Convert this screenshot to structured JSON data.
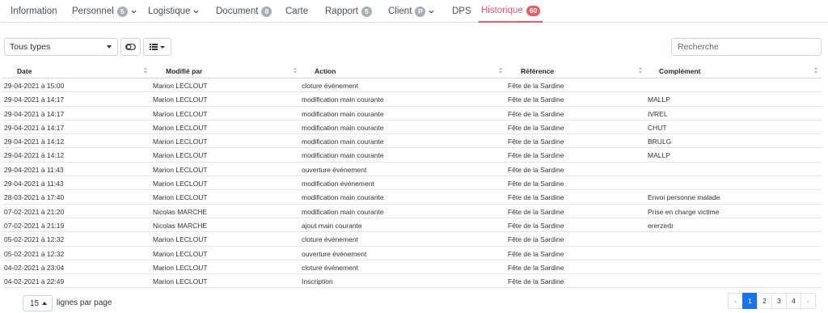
{
  "tabs": [
    {
      "label": "Information"
    },
    {
      "label": "Personnel",
      "badge": "5",
      "dropdown": true
    },
    {
      "label": "Logistique",
      "dropdown": true
    },
    {
      "label": "Document",
      "badge": "8"
    },
    {
      "label": "Carte"
    },
    {
      "label": "Rapport",
      "badge": "5"
    },
    {
      "label": "Client",
      "badge": "P",
      "dropdown": true
    },
    {
      "label": "DPS"
    },
    {
      "label": "Historique",
      "badge": "60",
      "active": true
    }
  ],
  "toolbar": {
    "type_select_value": "Tous types",
    "search_placeholder": "Recherche"
  },
  "table": {
    "columns": [
      "Date",
      "Modifié par",
      "Action",
      "Référence",
      "Complément"
    ],
    "rows": [
      [
        "29-04-2021 à 15:00",
        "Marion LECLOUT",
        "cloture événement",
        "Fête de la Sardine",
        ""
      ],
      [
        "29-04-2021 à 14:17",
        "Marion LECLOUT",
        "modification main courante",
        "Fête de la Sardine",
        "MALLP"
      ],
      [
        "29-04-2021 à 14:17",
        "Marion LECLOUT",
        "modification main courante",
        "Fête de la Sardine",
        "IVREL"
      ],
      [
        "29-04-2021 à 14:17",
        "Marion LECLOUT",
        "modification main courante",
        "Fête de la Sardine",
        "CHUT"
      ],
      [
        "29-04-2021 à 14:12",
        "Marion LECLOUT",
        "modification main courante",
        "Fête de la Sardine",
        "BRULG"
      ],
      [
        "29-04-2021 à 14:12",
        "Marion LECLOUT",
        "modification main courante",
        "Fête de la Sardine",
        "MALLP"
      ],
      [
        "29-04-2021 à 11:43",
        "Marion LECLOUT",
        "ouverture événement",
        "Fête de la Sardine",
        ""
      ],
      [
        "29-04-2021 à 11:43",
        "Marion LECLOUT",
        "modification événement",
        "Fête de la Sardine",
        ""
      ],
      [
        "28-03-2021 à 17:40",
        "Marion LECLOUT",
        "modification main courante",
        "Fête de la Sardine",
        "Envoi personne malade"
      ],
      [
        "07-02-2021 à 21:20",
        "Nicolas MARCHE",
        "modification main courante",
        "Fête de la Sardine",
        "Prise en charge victime"
      ],
      [
        "07-02-2021 à 21:19",
        "Nicolas MARCHE",
        "ajout main courante",
        "Fête de la Sardine",
        "ererzerb"
      ],
      [
        "05-02-2021 à 12:32",
        "Marion LECLOUT",
        "cloture événement",
        "Fête de la Sardine",
        ""
      ],
      [
        "05-02-2021 à 12:32",
        "Marion LECLOUT",
        "ouverture événement",
        "Fête de la Sardine",
        ""
      ],
      [
        "04-02-2021 à 23:04",
        "Marion LECLOUT",
        "cloture événement",
        "Fête de la Sardine",
        ""
      ],
      [
        "04-02-2021 à 22:49",
        "Marion LECLOUT",
        "Inscription",
        "Fête de la Sardine",
        ""
      ]
    ]
  },
  "footer": {
    "per_page_value": "15",
    "per_page_label": "lignes par page",
    "pagination": {
      "prev": "‹",
      "pages": [
        "1",
        "2",
        "3",
        "4"
      ],
      "next": "›",
      "current": "1"
    }
  },
  "colors": {
    "accent": "#e35d6a",
    "active_page": "#1a73e8",
    "badge_grey": "#a8aeb4"
  },
  "icons": {
    "toggle": "toggle-icon",
    "columns": "list-icon",
    "dropdown": "chevron-down-icon"
  }
}
